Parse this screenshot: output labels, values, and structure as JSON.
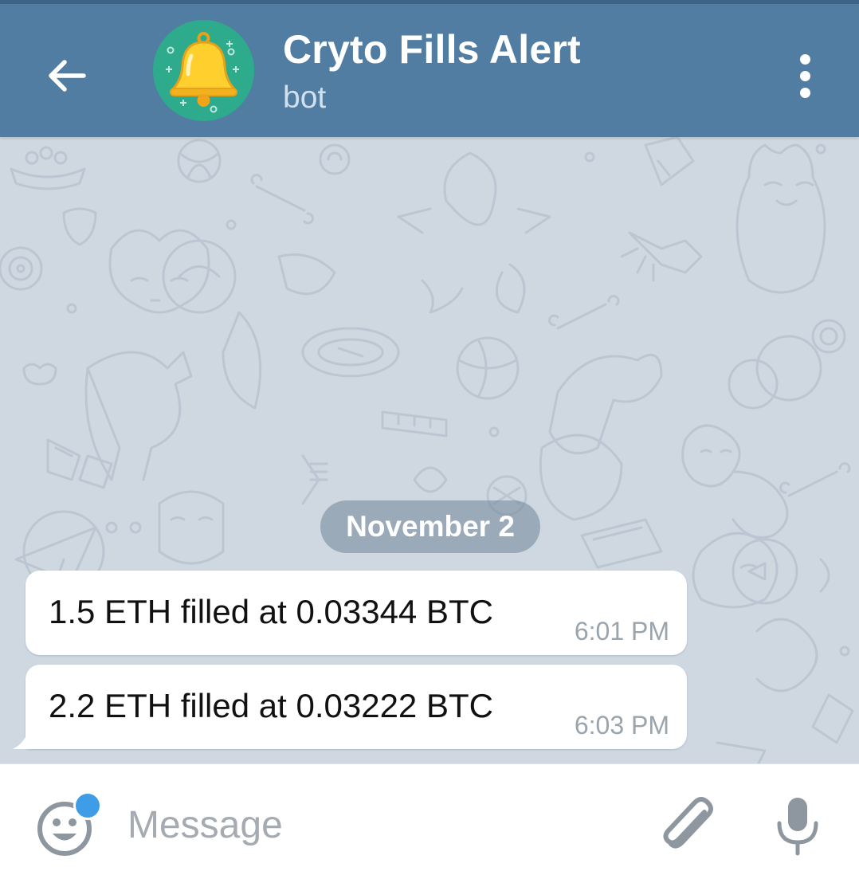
{
  "header": {
    "title": "Cryto Fills Alert",
    "subtitle": "bot",
    "back_icon": "arrow-left-icon",
    "menu_icon": "more-vertical-icon",
    "avatar_icon": "bell-icon",
    "bg_color": "#527da3",
    "avatar_color": "#2eaa8c"
  },
  "chat": {
    "date_separator": "November 2",
    "messages": [
      {
        "text": "1.5 ETH filled at 0.03344 BTC",
        "time": "6:01 PM"
      },
      {
        "text": "2.2 ETH filled at 0.03222 BTC",
        "time": "6:03 PM"
      }
    ]
  },
  "composer": {
    "placeholder": "Message",
    "emoji_icon": "emoji-smile-icon",
    "attach_icon": "paperclip-icon",
    "mic_icon": "microphone-icon",
    "notification_dot_color": "#3f9de8"
  }
}
